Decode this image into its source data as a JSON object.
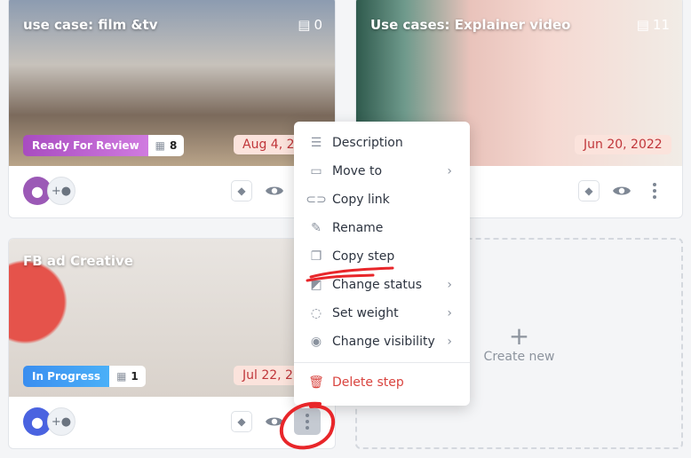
{
  "cards": [
    {
      "title": "use case: film &tv",
      "comments": "0",
      "status": "Ready For Review",
      "status_color": "#b34fc4",
      "tasks": "8",
      "date": "Aug 4, 20",
      "avatar_color": "#9b59b6"
    },
    {
      "title": "Use cases: Explainer video",
      "comments": "11",
      "date": "Jun 20, 2022"
    },
    {
      "title": "FB ad Creative",
      "status": "In Progress",
      "status_color": "#3a8ef0",
      "tasks": "1",
      "date": "Jul 22, 20",
      "avatar_color": "#4a63e0"
    }
  ],
  "create_new": {
    "icon": "plus-icon",
    "label": "Create new"
  },
  "menu": {
    "items": [
      {
        "label": "Description",
        "icon": "description-icon"
      },
      {
        "label": "Move to",
        "icon": "folder-move-icon",
        "submenu": true
      },
      {
        "label": "Copy link",
        "icon": "link-icon"
      },
      {
        "label": "Rename",
        "icon": "pencil-icon"
      },
      {
        "label": "Copy step",
        "icon": "copy-icon",
        "annotated": true
      },
      {
        "label": "Change status",
        "icon": "status-icon",
        "submenu": true
      },
      {
        "label": "Set weight",
        "icon": "weight-icon",
        "submenu": true
      },
      {
        "label": "Change visibility",
        "icon": "eye-icon",
        "submenu": true
      }
    ],
    "delete": {
      "label": "Delete step",
      "icon": "trash-icon",
      "color": "#d9443f"
    }
  },
  "annotation_color": "#e8262a"
}
